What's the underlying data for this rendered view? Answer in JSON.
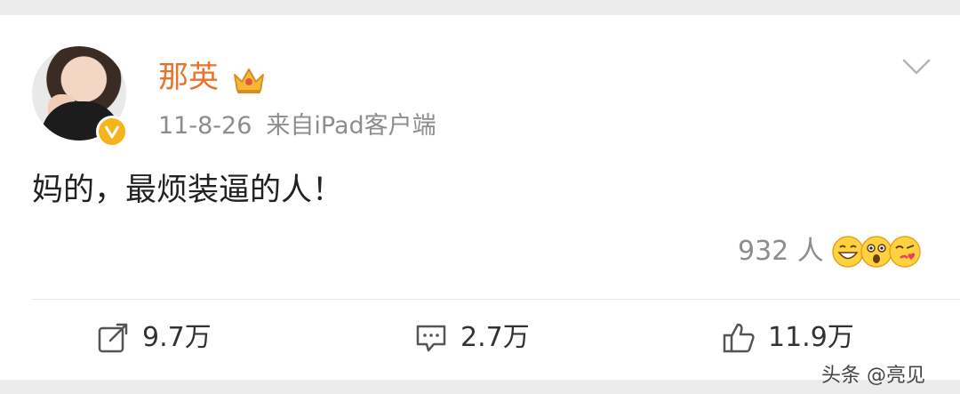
{
  "post": {
    "author_name": "那英",
    "date": "11-8-26",
    "source": "来自iPad客户端",
    "text": "妈的，最烦装逼的人！",
    "reaction_count": "932 人"
  },
  "actions": {
    "repost_count": "9.7万",
    "comment_count": "2.7万",
    "like_count": "11.9万"
  },
  "watermark": "头条 @亮见",
  "icons": {
    "verified": "verified-v-icon",
    "crown": "crown-icon",
    "menu": "chevron-down-icon",
    "repost": "repost-icon",
    "comment": "comment-icon",
    "like": "thumbs-up-icon",
    "reactions": [
      "laughing-emoji-icon",
      "surprised-emoji-icon",
      "kiss-emoji-icon"
    ]
  },
  "colors": {
    "author_name": "#e8742c",
    "badge": "#f5b41b",
    "meta_text": "#8d8d8d"
  }
}
